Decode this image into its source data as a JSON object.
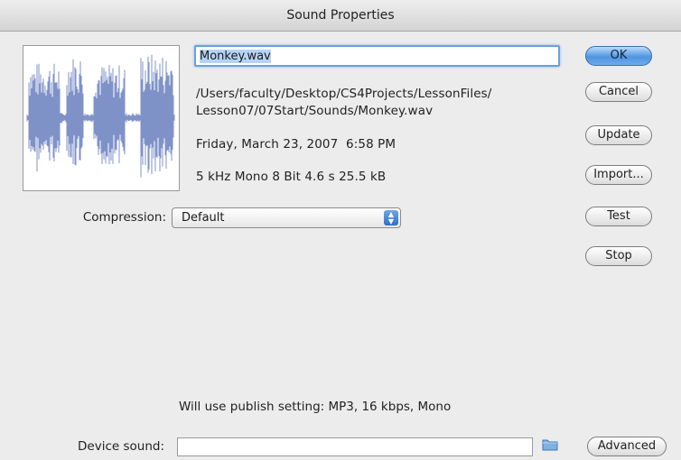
{
  "window": {
    "title": "Sound Properties"
  },
  "sound": {
    "name": "Monkey.wav",
    "path": "/Users/faculty/Desktop/CS4Projects/LessonFiles/\nLesson07/07Start/Sounds/Monkey.wav",
    "datetime": "Friday, March 23, 2007  6:58 PM",
    "format": "5 kHz Mono 8 Bit 4.6 s 25.5 kB"
  },
  "compression": {
    "label": "Compression:",
    "value": "Default"
  },
  "buttons": {
    "ok": "OK",
    "cancel": "Cancel",
    "update": "Update",
    "import": "Import...",
    "test": "Test",
    "stop": "Stop",
    "advanced": "Advanced"
  },
  "publish_note": "Will use publish setting: MP3, 16 kbps, Mono",
  "device": {
    "label": "Device sound:",
    "value": ""
  },
  "icons": {
    "waveform": "waveform-icon",
    "folder": "folder-icon",
    "select_arrows": "updown-arrows-icon"
  },
  "colors": {
    "waveform": "#7f92c8",
    "default_button": "#4f95e0"
  }
}
